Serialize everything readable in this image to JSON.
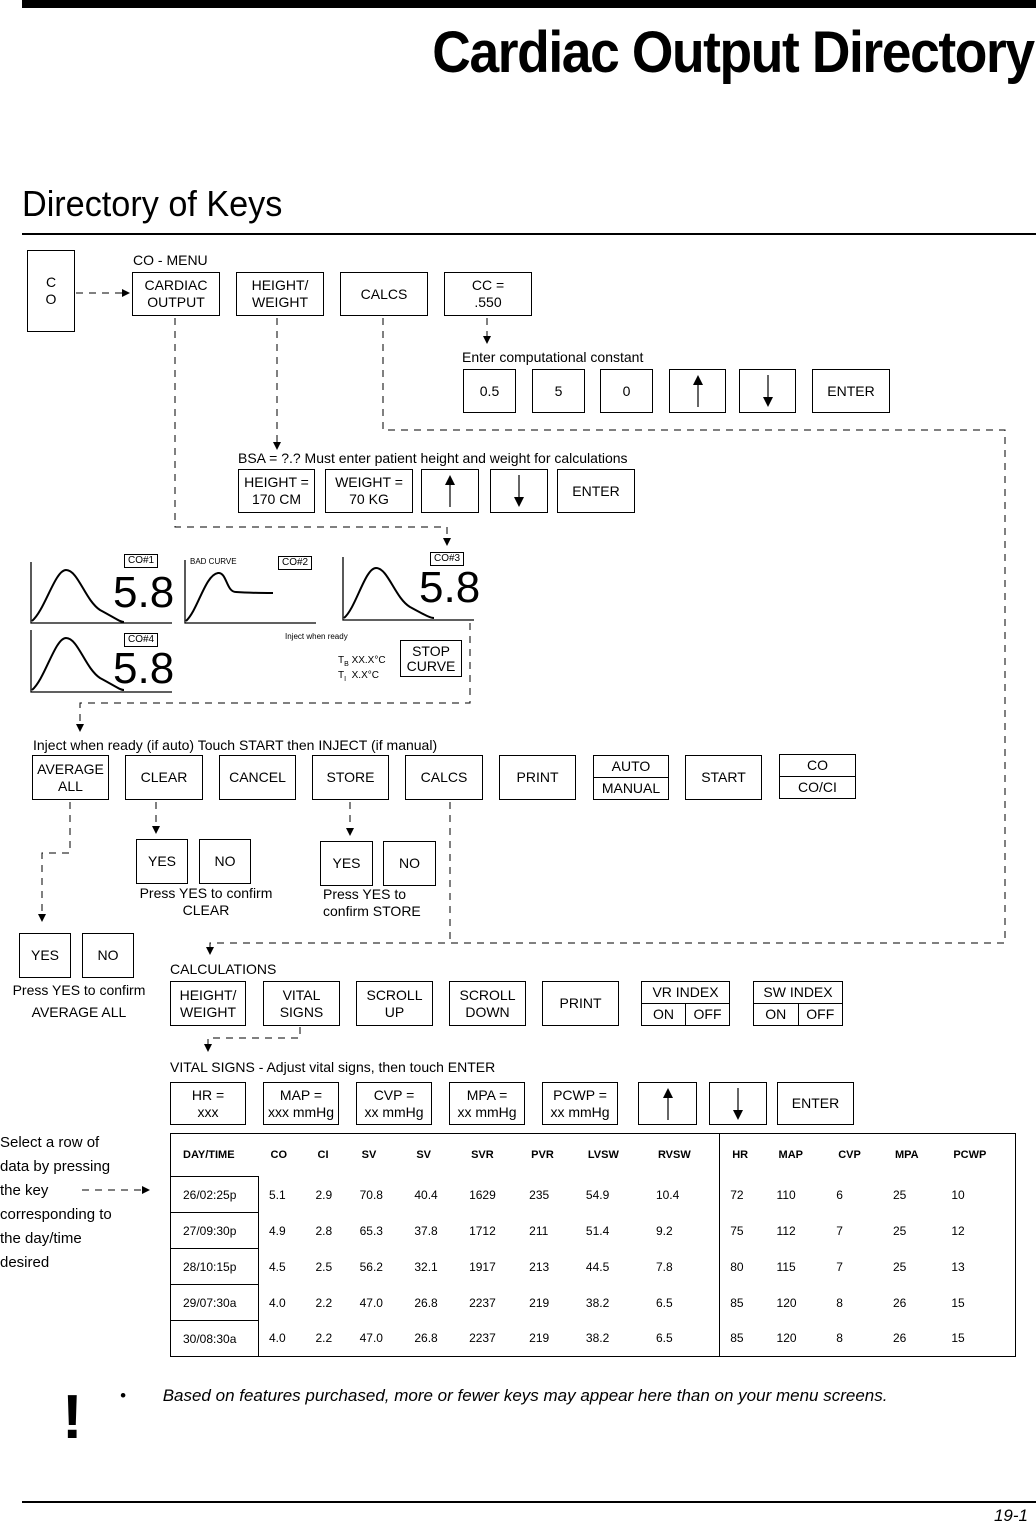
{
  "page": {
    "title": "Cardiac Output Directory",
    "subtitle": "Directory of Keys",
    "page_number": "19-1"
  },
  "co_key": {
    "line1": "C",
    "line2": "O"
  },
  "co_menu": {
    "label": "CO - MENU",
    "keys": [
      {
        "line1": "CARDIAC",
        "line2": "OUTPUT"
      },
      {
        "line1": "HEIGHT/",
        "line2": "WEIGHT"
      },
      {
        "line1": "CALCS"
      },
      {
        "line1": "CC =",
        "line2": ".550"
      }
    ]
  },
  "constant_menu": {
    "label": "Enter computational constant",
    "keys": [
      "0.5",
      "5",
      "0"
    ],
    "enter": "ENTER"
  },
  "bsa_menu": {
    "label": "BSA = ?.?  Must enter patient height and weight for calculations",
    "height": {
      "line1": "HEIGHT =",
      "line2": "170 CM"
    },
    "weight": {
      "line1": "WEIGHT =",
      "line2": "70 KG"
    },
    "enter": "ENTER"
  },
  "curves": {
    "co1": {
      "tag": "CO#1",
      "value": "5.8"
    },
    "co2": {
      "tag": "CO#2",
      "note": "BAD CURVE"
    },
    "co3": {
      "tag": "CO#3",
      "value": "5.8"
    },
    "co4": {
      "tag": "CO#4",
      "value": "5.8"
    },
    "inject_label": "Inject when ready",
    "tb_label": "T",
    "tb_sub": "B",
    "tb_value": "XX.X°C",
    "ti_label": "T",
    "ti_sub": "I",
    "ti_value": "X.X°C",
    "stop": {
      "line1": "STOP",
      "line2": "CURVE"
    }
  },
  "measure_menu": {
    "label": "Inject when ready (if auto) Touch START then INJECT (if manual)",
    "average": {
      "line1": "AVERAGE",
      "line2": "ALL"
    },
    "clear": "CLEAR",
    "cancel": "CANCEL",
    "store": "STORE",
    "calcs": "CALCS",
    "print": "PRINT",
    "mode": {
      "top": "AUTO",
      "bottom": "MANUAL"
    },
    "start": "START",
    "display": {
      "top": "CO",
      "bottom": "CO/CI"
    }
  },
  "confirm_clear": {
    "yes": "YES",
    "no": "NO",
    "line1": "Press YES to confirm",
    "line2": "CLEAR"
  },
  "confirm_store": {
    "yes": "YES",
    "no": "NO",
    "line1": "Press YES to",
    "line2": "confirm STORE"
  },
  "confirm_average": {
    "yes": "YES",
    "no": "NO",
    "line1": "Press YES to confirm",
    "line2": "AVERAGE ALL"
  },
  "calculations_menu": {
    "label": "CALCULATIONS",
    "height_weight": {
      "line1": "HEIGHT/",
      "line2": "WEIGHT"
    },
    "vital_signs": {
      "line1": "VITAL",
      "line2": "SIGNS"
    },
    "scroll_up": {
      "line1": "SCROLL",
      "line2": "UP"
    },
    "scroll_down": {
      "line1": "SCROLL",
      "line2": "DOWN"
    },
    "print": "PRINT",
    "vr_index": {
      "title": "VR INDEX",
      "on": "ON",
      "off": "OFF"
    },
    "sw_index": {
      "title": "SW INDEX",
      "on": "ON",
      "off": "OFF"
    }
  },
  "vitals_menu": {
    "label": "VITAL SIGNS - Adjust vital signs, then touch ENTER",
    "keys": [
      {
        "line1": "HR =",
        "line2": "xxx"
      },
      {
        "line1": "MAP =",
        "line2": "xxx mmHg"
      },
      {
        "line1": "CVP =",
        "line2": "xx mmHg"
      },
      {
        "line1": "MPA =",
        "line2": "xx mmHg"
      },
      {
        "line1": "PCWP =",
        "line2": "xx mmHg"
      }
    ],
    "enter": "ENTER"
  },
  "select_note": [
    "Select a row of",
    "data by pressing",
    "the key",
    "corresponding to",
    "the day/time",
    "desired"
  ],
  "table": {
    "headers": [
      "DAY/TIME",
      "CO",
      "CI",
      "SV",
      "SV",
      "SVR",
      "PVR",
      "LVSW",
      "RVSW",
      "HR",
      "MAP",
      "CVP",
      "MPA",
      "PCWP"
    ],
    "rows": [
      [
        "26/02:25p",
        "5.1",
        "2.9",
        "70.8",
        "40.4",
        "1629",
        "235",
        "54.9",
        "10.4",
        "72",
        "110",
        "6",
        "25",
        "10"
      ],
      [
        "27/09:30p",
        "4.9",
        "2.8",
        "65.3",
        "37.8",
        "1712",
        "211",
        "51.4",
        "9.2",
        "75",
        "112",
        "7",
        "25",
        "12"
      ],
      [
        "28/10:15p",
        "4.5",
        "2.5",
        "56.2",
        "32.1",
        "1917",
        "213",
        "44.5",
        "7.8",
        "80",
        "115",
        "7",
        "25",
        "13"
      ],
      [
        "29/07:30a",
        "4.0",
        "2.2",
        "47.0",
        "26.8",
        "2237",
        "219",
        "38.2",
        "6.5",
        "85",
        "120",
        "8",
        "26",
        "15"
      ],
      [
        "30/08:30a",
        "4.0",
        "2.2",
        "47.0",
        "26.8",
        "2237",
        "219",
        "38.2",
        "6.5",
        "85",
        "120",
        "8",
        "26",
        "15"
      ]
    ]
  },
  "footnote": {
    "bullet": "•",
    "text": "Based on features purchased, more or fewer keys may appear here than on your menu screens.",
    "icon": "!"
  }
}
